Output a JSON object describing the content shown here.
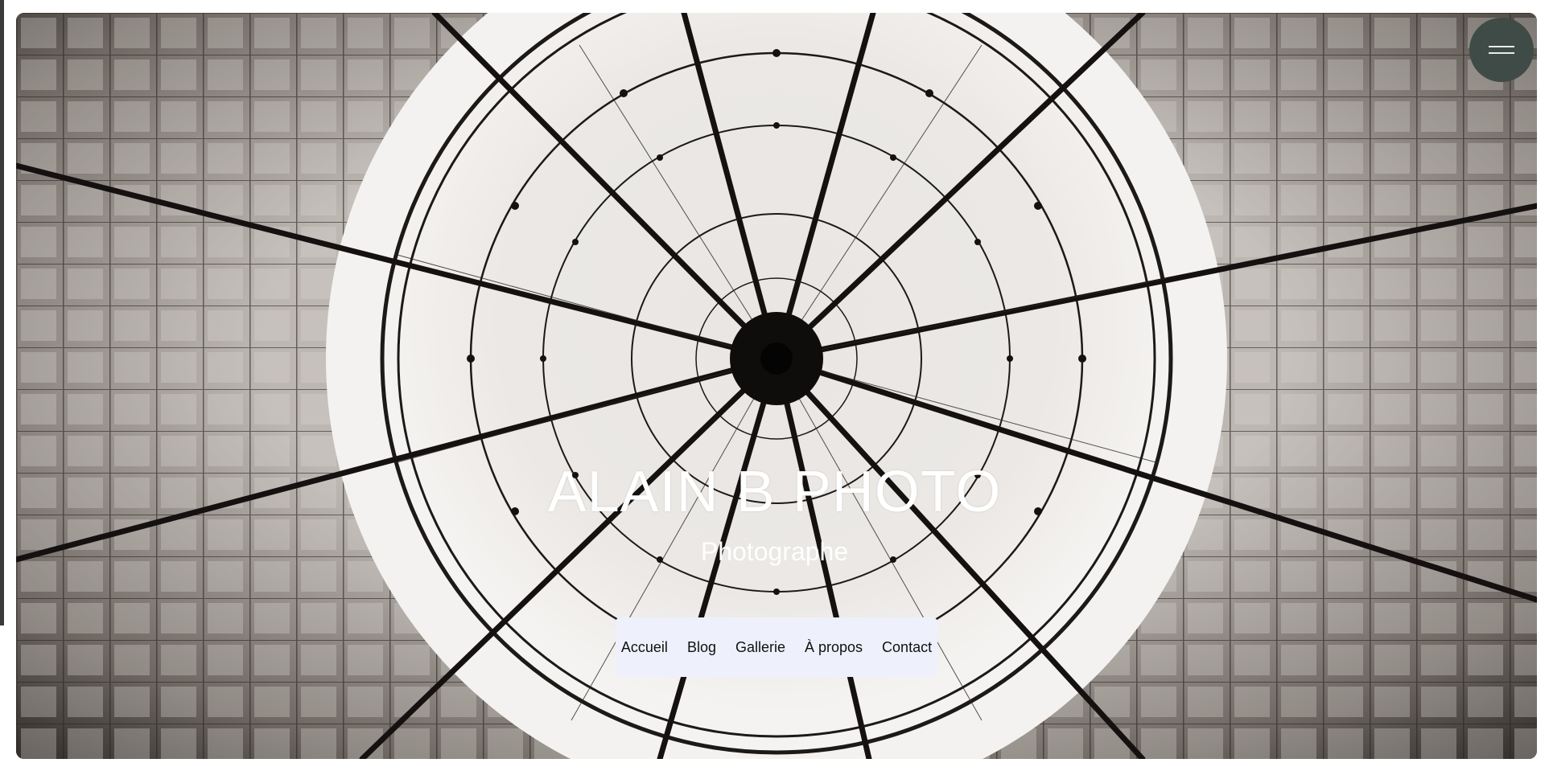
{
  "site": {
    "title": "ALAIN B PHOTO",
    "subtitle": "Photographe"
  },
  "nav": {
    "items": [
      {
        "label": "Accueil"
      },
      {
        "label": "Blog"
      },
      {
        "label": "Gallerie"
      },
      {
        "label": "À propos"
      },
      {
        "label": "Contact"
      }
    ]
  },
  "menu_button": {
    "icon": "hamburger-icon"
  },
  "hero_image": {
    "subject": "glass-dome-ceiling-icon"
  },
  "colors": {
    "nav_background": "#eef1fc",
    "menu_button": "#3f4b47",
    "title_text": "#ffffff"
  }
}
